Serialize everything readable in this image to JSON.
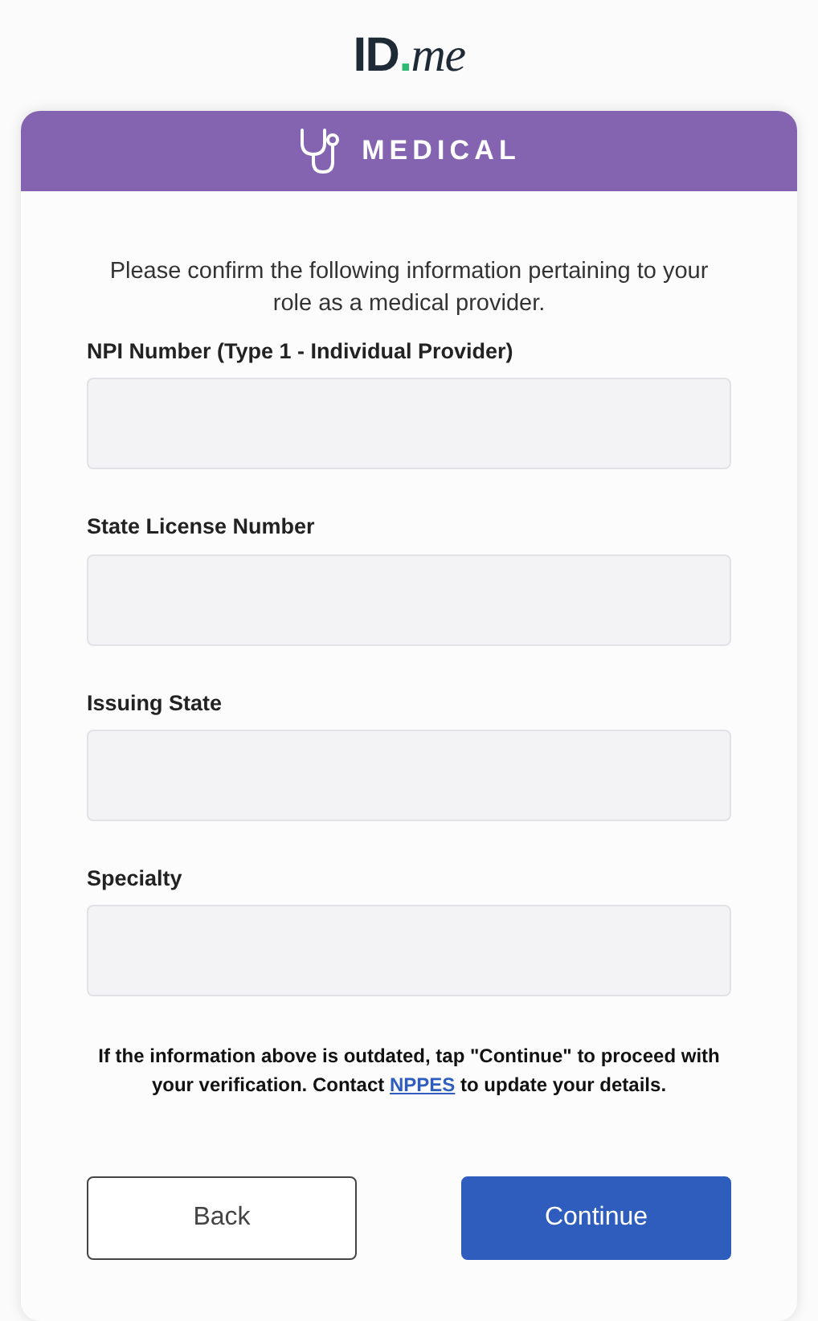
{
  "logo": {
    "main": "ID",
    "dot": ".",
    "suffix": "me"
  },
  "header": {
    "title": "MEDICAL"
  },
  "intro": "Please confirm the following information pertaining to your role as a medical provider.",
  "fields": [
    {
      "label": "NPI Number (Type 1 - Individual Provider)"
    },
    {
      "label": "State License Number"
    },
    {
      "label": "Issuing State"
    },
    {
      "label": "Specialty"
    }
  ],
  "note": {
    "before": "If the information above is outdated, tap \"Continue\" to proceed with your verification. Contact ",
    "link": "NPPES",
    "after": " to update your details."
  },
  "buttons": [
    {
      "label": "Back",
      "kind": "secondary"
    },
    {
      "label": "Continue",
      "kind": "primary"
    }
  ]
}
